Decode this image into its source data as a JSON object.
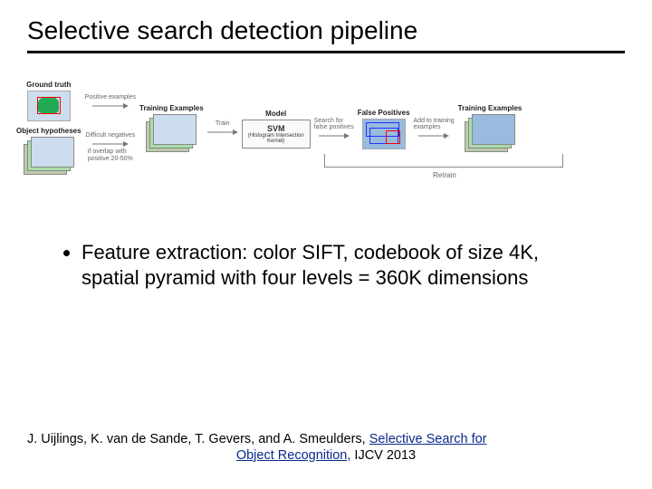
{
  "title": "Selective search detection pipeline",
  "diagram": {
    "ground_truth": "Ground truth",
    "object_hypotheses": "Object hypotheses",
    "positive_examples": "Positive examples",
    "difficult_negatives": "Difficult negatives",
    "overlap_note": "if overlap with\npositive 20-50%",
    "training_examples": "Training Examples",
    "train": "Train",
    "model": "Model",
    "svm": "SVM",
    "svm_sub": "(Histogram Intersection\nKernel)",
    "search_for": "Search for\nfalse positives",
    "false_positives": "False Positives",
    "add_to_training": "Add to training\nexamples",
    "training_examples2": "Training Examples",
    "retrain": "Retrain"
  },
  "bullet": "Feature extraction: color SIFT, codebook of size 4K, spatial pyramid with four levels = 360K dimensions",
  "citation": {
    "authors": "J. Uijlings, K. van de Sande, T. Gevers, and A. Smeulders, ",
    "link_text_a": "Selective Search for",
    "link_text_b": "Object Recognition,",
    "tail": " IJCV 2013"
  }
}
